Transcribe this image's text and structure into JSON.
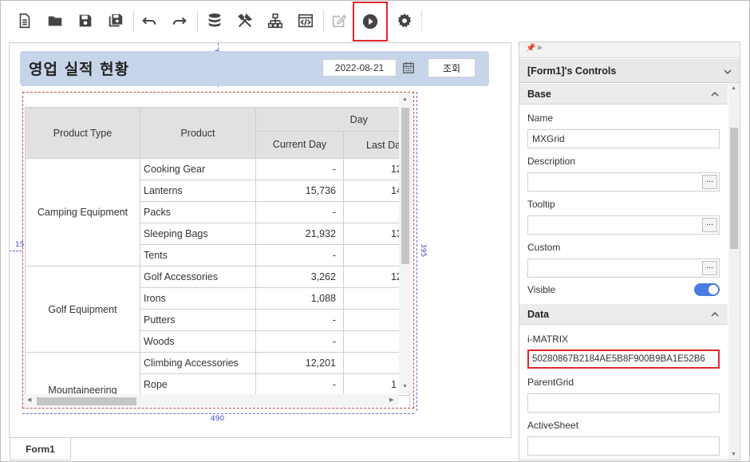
{
  "toolbar": {
    "buttons": [
      {
        "icon": "new-document-icon"
      },
      {
        "icon": "open-folder-icon"
      },
      {
        "icon": "save-icon"
      },
      {
        "icon": "save-all-icon"
      },
      {
        "icon": "undo-icon"
      },
      {
        "icon": "redo-icon"
      },
      {
        "icon": "database-icon"
      },
      {
        "icon": "tools-icon"
      },
      {
        "icon": "hierarchy-icon"
      },
      {
        "icon": "code-view-icon"
      },
      {
        "icon": "edit-icon"
      },
      {
        "icon": "run-icon",
        "selected": true
      },
      {
        "icon": "settings-icon"
      }
    ]
  },
  "colors": {
    "accent": "#4a7be0",
    "highlight": "#e0262d",
    "header_panel": "#c7d5ea"
  },
  "design": {
    "title": "영업 실적 현황",
    "date_value": "2022-08-21",
    "search_label": "조회",
    "dims": {
      "top": "62",
      "left": "15",
      "right": "395",
      "bottom": "490"
    }
  },
  "grid": {
    "headers": {
      "product_type": "Product Type",
      "product": "Product",
      "day": "Day",
      "current_day": "Current Day",
      "last_day": "Last Day"
    },
    "groups": [
      {
        "name": "Camping Equipment",
        "rows": [
          {
            "product": "Cooking Gear",
            "current": "-",
            "last": "12"
          },
          {
            "product": "Lanterns",
            "current": "15,736",
            "last": "14"
          },
          {
            "product": "Packs",
            "current": "-",
            "last": ""
          },
          {
            "product": "Sleeping Bags",
            "current": "21,932",
            "last": "13"
          },
          {
            "product": "Tents",
            "current": "-",
            "last": ""
          }
        ]
      },
      {
        "name": "Golf Equipment",
        "rows": [
          {
            "product": "Golf Accessories",
            "current": "3,262",
            "last": "12"
          },
          {
            "product": "Irons",
            "current": "1,088",
            "last": ""
          },
          {
            "product": "Putters",
            "current": "-",
            "last": ""
          },
          {
            "product": "Woods",
            "current": "-",
            "last": ""
          }
        ]
      },
      {
        "name": "Mountaineering",
        "rows": [
          {
            "product": "Climbing Accessories",
            "current": "12,201",
            "last": ""
          },
          {
            "product": "Rope",
            "current": "-",
            "last": "1"
          }
        ]
      }
    ]
  },
  "tabs": {
    "form1": "Form1"
  },
  "props": {
    "title": "[Form1]'s Controls",
    "sections": {
      "base": "Base",
      "data": "Data"
    },
    "fields": {
      "name_label": "Name",
      "name_value": "MXGrid",
      "description_label": "Description",
      "tooltip_label": "Tooltip",
      "custom_label": "Custom",
      "visible_label": "Visible",
      "visible_on": true,
      "imatrix_label": "i-MATRIX",
      "imatrix_value": "50280867B2184AE5B8F900B9BA1E52B6",
      "parentgrid_label": "ParentGrid",
      "activesheet_label": "ActiveSheet",
      "ellipsis": "..."
    }
  }
}
